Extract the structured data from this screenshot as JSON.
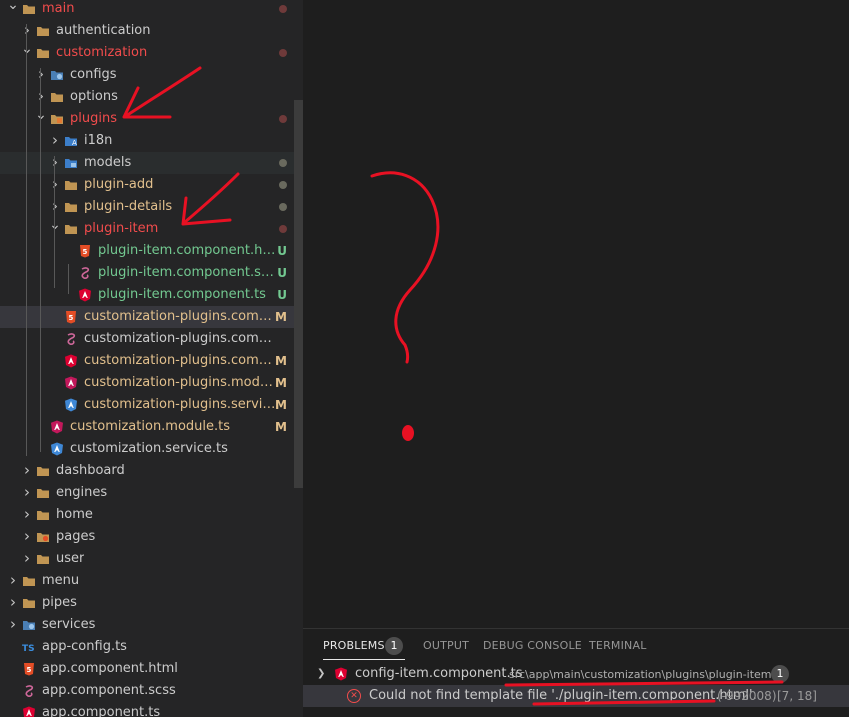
{
  "explorer": {
    "tree": [
      {
        "name": "main",
        "depth": 0,
        "type": "folder",
        "open": true,
        "color": "#f14c4c",
        "dot": "#6f3a3a"
      },
      {
        "name": "authentication",
        "depth": 1,
        "type": "folder",
        "open": false,
        "color": "#cccccc"
      },
      {
        "name": "customization",
        "depth": 1,
        "type": "folder",
        "open": true,
        "color": "#f14c4c",
        "dot": "#6f3a3a"
      },
      {
        "name": "configs",
        "depth": 2,
        "type": "folder-config",
        "open": false,
        "color": "#cccccc"
      },
      {
        "name": "options",
        "depth": 2,
        "type": "folder",
        "open": false,
        "color": "#cccccc"
      },
      {
        "name": "plugins",
        "depth": 2,
        "type": "folder-plugin",
        "open": true,
        "color": "#f14c4c",
        "dot": "#6f3a3a"
      },
      {
        "name": "i18n",
        "depth": 3,
        "type": "folder-i18n",
        "open": false,
        "color": "#cccccc"
      },
      {
        "name": "models",
        "depth": 3,
        "type": "folder-models",
        "open": false,
        "color": "#cccccc",
        "dot": "#6a6a5e",
        "hover": true
      },
      {
        "name": "plugin-add",
        "depth": 3,
        "type": "folder",
        "open": false,
        "color": "#e2c08d",
        "dot": "#6a6a5e"
      },
      {
        "name": "plugin-details",
        "depth": 3,
        "type": "folder",
        "open": false,
        "color": "#e2c08d",
        "dot": "#6a6a5e"
      },
      {
        "name": "plugin-item",
        "depth": 3,
        "type": "folder",
        "open": true,
        "color": "#f14c4c",
        "dot": "#6f3a3a"
      },
      {
        "name": "plugin-item.component.html",
        "depth": 4,
        "type": "html",
        "color": "#73c991",
        "badge": "U",
        "badgeColor": "#73c991"
      },
      {
        "name": "plugin-item.component.scss",
        "depth": 4,
        "type": "scss",
        "color": "#73c991",
        "badge": "U",
        "badgeColor": "#73c991"
      },
      {
        "name": "plugin-item.component.ts",
        "depth": 4,
        "type": "angular",
        "color": "#73c991",
        "badge": "U",
        "badgeColor": "#73c991"
      },
      {
        "name": "customization-plugins.compon...",
        "depth": 3,
        "type": "html",
        "color": "#e2c08d",
        "badge": "M",
        "badgeColor": "#e2c08d",
        "selected": true
      },
      {
        "name": "customization-plugins.component.s...",
        "depth": 3,
        "type": "scss",
        "color": "#cccccc"
      },
      {
        "name": "customization-plugins.compon...",
        "depth": 3,
        "type": "angular",
        "color": "#e2c08d",
        "badge": "M",
        "badgeColor": "#e2c08d"
      },
      {
        "name": "customization-plugins.module.ts",
        "depth": 3,
        "type": "angular-module",
        "color": "#e2c08d",
        "badge": "M",
        "badgeColor": "#e2c08d"
      },
      {
        "name": "customization-plugins.service.ts",
        "depth": 3,
        "type": "angular-service",
        "color": "#e2c08d",
        "badge": "M",
        "badgeColor": "#e2c08d"
      },
      {
        "name": "customization.module.ts",
        "depth": 2,
        "type": "angular-module",
        "color": "#e2c08d",
        "badge": "M",
        "badgeColor": "#e2c08d"
      },
      {
        "name": "customization.service.ts",
        "depth": 2,
        "type": "angular-service",
        "color": "#cccccc"
      },
      {
        "name": "dashboard",
        "depth": 1,
        "type": "folder",
        "open": false,
        "color": "#cccccc"
      },
      {
        "name": "engines",
        "depth": 1,
        "type": "folder",
        "open": false,
        "color": "#cccccc"
      },
      {
        "name": "home",
        "depth": 1,
        "type": "folder",
        "open": false,
        "color": "#cccccc"
      },
      {
        "name": "pages",
        "depth": 1,
        "type": "folder-pages",
        "open": false,
        "color": "#cccccc"
      },
      {
        "name": "user",
        "depth": 1,
        "type": "folder",
        "open": false,
        "color": "#cccccc"
      },
      {
        "name": "menu",
        "depth": 0,
        "type": "folder",
        "open": false,
        "color": "#cccccc"
      },
      {
        "name": "pipes",
        "depth": 0,
        "type": "folder",
        "open": false,
        "color": "#cccccc"
      },
      {
        "name": "services",
        "depth": 0,
        "type": "folder-config",
        "open": false,
        "color": "#cccccc"
      },
      {
        "name": "app-config.ts",
        "depth": 0,
        "type": "ts",
        "color": "#cccccc"
      },
      {
        "name": "app.component.html",
        "depth": 0,
        "type": "html",
        "color": "#cccccc"
      },
      {
        "name": "app.component.scss",
        "depth": 0,
        "type": "scss",
        "color": "#cccccc"
      },
      {
        "name": "app.component.ts",
        "depth": 0,
        "type": "angular",
        "color": "#cccccc"
      }
    ]
  },
  "panel": {
    "tabs": [
      {
        "label": "PROBLEMS",
        "active": true,
        "count": "1"
      },
      {
        "label": "OUTPUT",
        "active": false
      },
      {
        "label": "DEBUG CONSOLE",
        "active": false
      },
      {
        "label": "TERMINAL",
        "active": false
      }
    ],
    "file_entry": {
      "filename": "config-item.component.ts",
      "path": "src\\app\\main\\customization\\plugins\\plugin-item",
      "count": "1"
    },
    "error": {
      "message": "Could not find template file './plugin-item.component.html'.",
      "code": "(-992008)",
      "position": "[7, 18]"
    }
  },
  "colors": {
    "accent_error": "#f14c4c",
    "untracked": "#73c991",
    "modified": "#e2c08d",
    "folder": "#c09553",
    "annotation": "#e81123"
  }
}
